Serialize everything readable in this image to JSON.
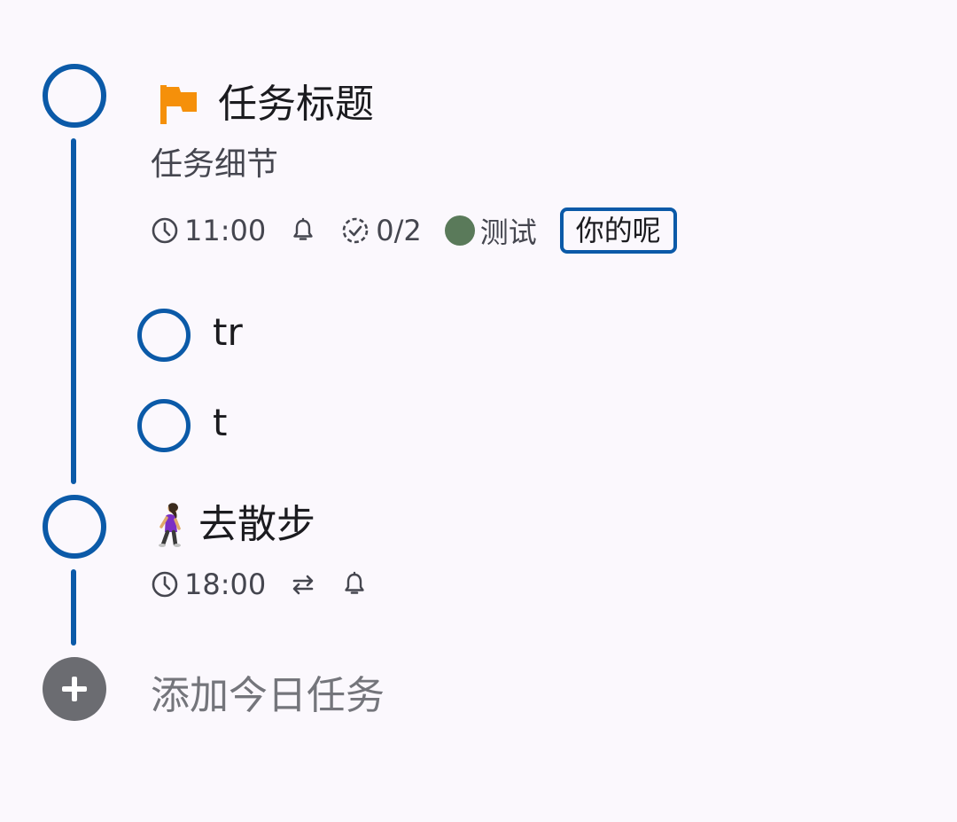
{
  "tasks": [
    {
      "title": "任务标题",
      "detail": "任务细节",
      "time": "11:00",
      "checklist": "0/2",
      "list_name": "测试",
      "list_color": "#5a7a5a",
      "tag": "你的呢",
      "flag_color": "#f5900a",
      "icons": [
        "clock-icon",
        "bell-icon",
        "checklist-progress-icon"
      ],
      "subtasks": [
        {
          "title": "tr"
        },
        {
          "title": "t"
        }
      ]
    },
    {
      "title": "去散步",
      "emoji": "woman-walking",
      "time": "18:00",
      "icons": [
        "clock-icon",
        "repeat-icon",
        "bell-icon"
      ]
    }
  ],
  "add_task": {
    "label": "添加今日任务",
    "icon": "plus-icon"
  },
  "colors": {
    "accent": "#0b5aa8",
    "background": "#fbf8fd",
    "add_button": "#6b6c71"
  }
}
